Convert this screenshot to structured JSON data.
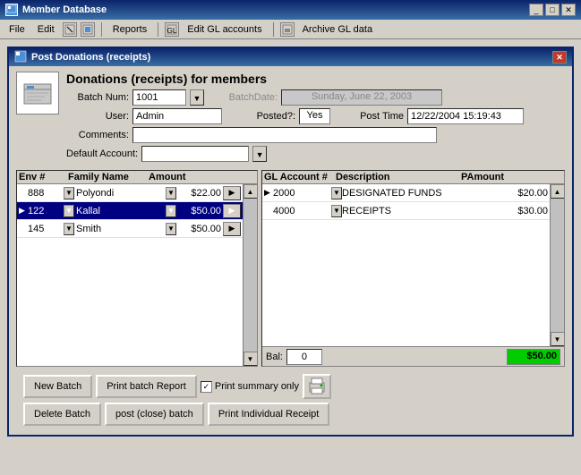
{
  "titleBar": {
    "label": "Member Database",
    "controls": [
      "_",
      "□",
      "✕"
    ]
  },
  "menuBar": {
    "items": [
      "File",
      "Edit",
      "Reports",
      "Edit GL accounts",
      "Archive GL data"
    ]
  },
  "dialog": {
    "title": "Post Donations (receipts)",
    "mainTitle": "Donations (receipts) for members",
    "fields": {
      "batchNumLabel": "Batch Num:",
      "batchNum": "1001",
      "batchDateLabel": "BatchDate:",
      "batchDate": "Sunday, June 22, 2003",
      "userLabel": "User:",
      "userValue": "Admin",
      "postedLabel": "Posted?:",
      "postedValue": "Yes",
      "postTimeLabel": "Post Time",
      "postTimeValue": "12/22/2004 15:19:43",
      "commentsLabel": "Comments:",
      "commentsValue": "",
      "defaultAccountLabel": "Default Account:",
      "defaultAccountValue": ""
    },
    "leftTable": {
      "columns": [
        "Env #",
        "Family Name",
        "Amount",
        ""
      ],
      "rows": [
        {
          "env": "888",
          "family": "Polyondi",
          "amount": "$22.00",
          "selected": false
        },
        {
          "env": "122",
          "family": "Kallal",
          "amount": "$50.00",
          "selected": true
        },
        {
          "env": "145",
          "family": "Smith",
          "amount": "$50.00",
          "selected": false
        }
      ]
    },
    "rightTable": {
      "columns": [
        "GL Account #",
        "Description",
        "PAmount"
      ],
      "rows": [
        {
          "glAccount": "2000",
          "description": "DESIGNATED FUNDS",
          "pamount": "$20.00"
        },
        {
          "glAccount": "4000",
          "description": "RECEIPTS",
          "pamount": "$30.00"
        }
      ],
      "balance": {
        "label": "Bal:",
        "value": "0",
        "total": "$50.00"
      }
    },
    "buttons": {
      "row1": {
        "newBatch": "New Batch",
        "printBatchReport": "Print batch Report",
        "printSummaryOnly": "Print summary only",
        "printSummaryChecked": true
      },
      "row2": {
        "deleteBatch": "Delete Batch",
        "postCloseBatch": "post (close) batch",
        "printIndividualReceipt": "Print Individual Receipt"
      }
    }
  }
}
